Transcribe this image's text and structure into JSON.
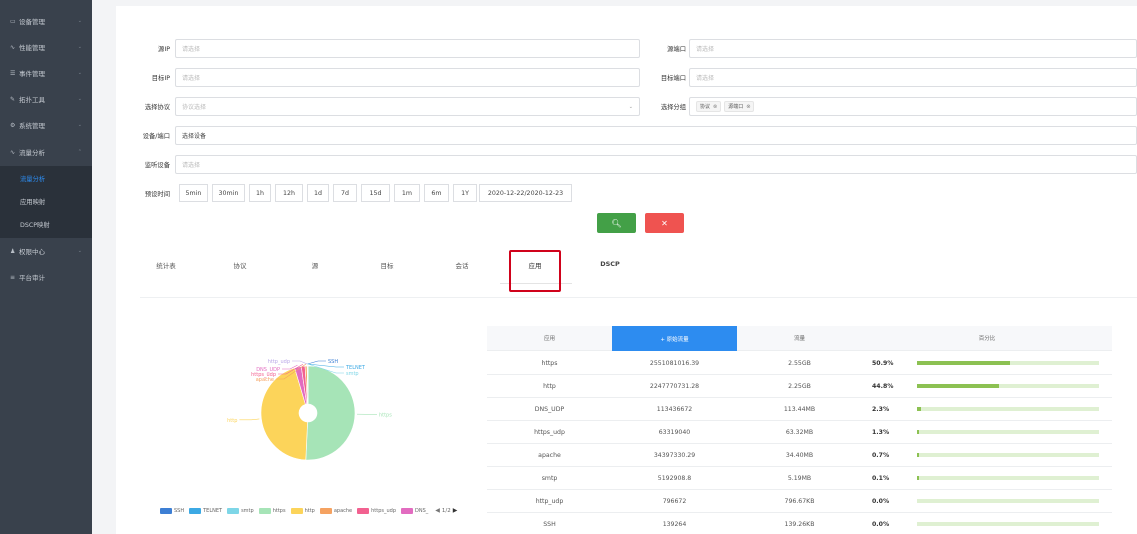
{
  "sidebar": {
    "items": [
      {
        "icon": "monitor-icon",
        "glyph": "▭",
        "label": "设备管理"
      },
      {
        "icon": "trend-icon",
        "glyph": "∿",
        "label": "性能管理"
      },
      {
        "icon": "list-icon",
        "glyph": "☰",
        "label": "事件管理"
      },
      {
        "icon": "wrench-icon",
        "glyph": "✎",
        "label": "拓扑工具"
      },
      {
        "icon": "gear-icon",
        "glyph": "⚙",
        "label": "系统管理"
      },
      {
        "icon": "chart-icon",
        "glyph": "∿",
        "label": "流量分析"
      },
      {
        "icon": "user-icon",
        "glyph": "♟",
        "label": "权限中心"
      },
      {
        "icon": "audit-icon",
        "glyph": "≡",
        "label": "平台审计"
      }
    ],
    "sub_items": [
      "流量分析",
      "应用映射",
      "DSCP映射"
    ]
  },
  "filters": {
    "src_ip": {
      "label": "源IP",
      "placeholder": "请选择"
    },
    "src_port": {
      "label": "源端口",
      "placeholder": "请选择"
    },
    "dst_ip": {
      "label": "目标IP",
      "placeholder": "请选择"
    },
    "dst_port": {
      "label": "目标端口",
      "placeholder": "请选择"
    },
    "protocol": {
      "label": "选择协议",
      "placeholder": "协议选择"
    },
    "group": {
      "label": "选择分组",
      "tags": [
        "协议",
        "源端口"
      ]
    },
    "device_port": {
      "label": "设备/端口",
      "value": "选择设备"
    },
    "listen_device": {
      "label": "监听设备",
      "placeholder": "请选择"
    },
    "preset_time": {
      "label": "预设时间"
    }
  },
  "time_buttons": [
    "5min",
    "30min",
    "1h",
    "12h",
    "1d",
    "7d",
    "15d",
    "1m",
    "6m",
    "1Y",
    "2020-12-22/2020-12-23"
  ],
  "actions": {
    "search_icon": "search-icon",
    "clear_icon": "close-icon",
    "search_color": "#43a047",
    "clear_color": "#ef5350"
  },
  "tabs": [
    "统计表",
    "协议",
    "源",
    "目标",
    "会话",
    "应用",
    "DSCP"
  ],
  "active_tab": "应用",
  "table": {
    "headers": [
      "应用",
      "+ 原始流量",
      "流量",
      "百分比"
    ],
    "rows": [
      {
        "app": "https",
        "raw": "2551081016.39",
        "traffic": "2.55GB",
        "percent": "50.9%",
        "fraction": 0.509
      },
      {
        "app": "http",
        "raw": "2247770731.28",
        "traffic": "2.25GB",
        "percent": "44.8%",
        "fraction": 0.448
      },
      {
        "app": "DNS_UDP",
        "raw": "113436672",
        "traffic": "113.44MB",
        "percent": "2.3%",
        "fraction": 0.023
      },
      {
        "app": "https_udp",
        "raw": "63319040",
        "traffic": "63.32MB",
        "percent": "1.3%",
        "fraction": 0.013
      },
      {
        "app": "apache",
        "raw": "34397330.29",
        "traffic": "34.40MB",
        "percent": "0.7%",
        "fraction": 0.007
      },
      {
        "app": "smtp",
        "raw": "5192908.8",
        "traffic": "5.19MB",
        "percent": "0.1%",
        "fraction": 0.001
      },
      {
        "app": "http_udp",
        "raw": "796672",
        "traffic": "796.67KB",
        "percent": "0.0%",
        "fraction": 0.0
      },
      {
        "app": "SSH",
        "raw": "139264",
        "traffic": "139.26KB",
        "percent": "0.0%",
        "fraction": 0.0
      }
    ]
  },
  "chart_data": {
    "type": "pie",
    "donut": true,
    "slices": [
      {
        "label": "https",
        "value": 50.9,
        "color": "#a6e4b7"
      },
      {
        "label": "http",
        "value": 44.8,
        "color": "#fcd45a"
      },
      {
        "label": "DNS_UDP",
        "value": 2.3,
        "color": "#e26cc0"
      },
      {
        "label": "https_udp",
        "value": 1.3,
        "color": "#f26190"
      },
      {
        "label": "apache",
        "value": 0.7,
        "color": "#f5a261"
      },
      {
        "label": "http_udp",
        "value": 0.1,
        "color": "#b9a7e8"
      },
      {
        "label": "SSH",
        "value": 0.1,
        "color": "#3d7fd4"
      },
      {
        "label": "TELNET",
        "value": 0.05,
        "color": "#3ca9e4"
      },
      {
        "label": "smtp",
        "value": 0.05,
        "color": "#7ed6e7"
      }
    ],
    "legend": {
      "items": [
        {
          "label": "SSH",
          "color": "#3d7fd4"
        },
        {
          "label": "TELNET",
          "color": "#3ca9e4"
        },
        {
          "label": "smtp",
          "color": "#7ed6e7"
        },
        {
          "label": "https",
          "color": "#a6e4b7"
        },
        {
          "label": "http",
          "color": "#fcd45a"
        },
        {
          "label": "apache",
          "color": "#f5a261"
        },
        {
          "label": "https_udp",
          "color": "#f26190"
        },
        {
          "label": "DNS_",
          "color": "#e26cc0"
        }
      ],
      "page": "1/2",
      "placement": "bottom"
    }
  }
}
